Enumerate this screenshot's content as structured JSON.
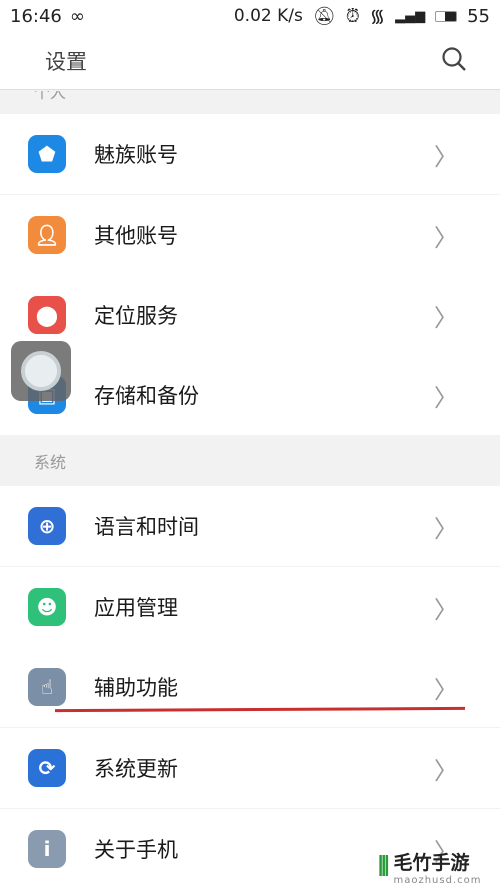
{
  "status_bar": {
    "time": "16:46",
    "speed": "0.02 K/s",
    "battery": "55"
  },
  "header": {
    "title": "设置",
    "search_icon": "search-icon"
  },
  "sections": [
    {
      "title": "个人"
    },
    {
      "title": "系统"
    }
  ],
  "items": [
    {
      "label": "魅族账号",
      "icon": "shield-icon",
      "color": "#1e88e5"
    },
    {
      "label": "其他账号",
      "icon": "person-icon",
      "color": "#f28b3c"
    },
    {
      "label": "定位服务",
      "icon": "location-pin-icon",
      "color": "#e8504a"
    },
    {
      "label": "存储和备份",
      "icon": "storage-icon",
      "color": "#1e88e5"
    },
    {
      "label": "语言和时间",
      "icon": "globe-icon",
      "color": "#2f6fd6"
    },
    {
      "label": "应用管理",
      "icon": "android-icon",
      "color": "#2fc07a"
    },
    {
      "label": "辅助功能",
      "icon": "hand-icon",
      "color": "#7b8fa6"
    },
    {
      "label": "系统更新",
      "icon": "refresh-icon",
      "color": "#2a72d8"
    },
    {
      "label": "关于手机",
      "icon": "info-icon",
      "color": "#8a9bb0"
    }
  ],
  "watermark": {
    "brand": "毛竹手游",
    "url": "maozhusd.com"
  }
}
